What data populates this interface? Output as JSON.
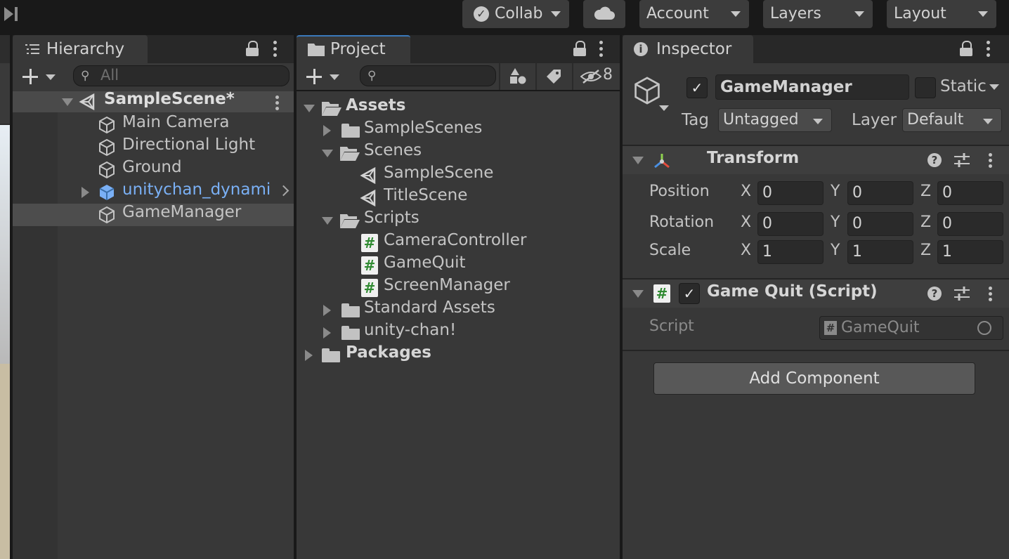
{
  "toolbar": {
    "collab_label": "Collab",
    "account_label": "Account",
    "layers_label": "Layers",
    "layout_label": "Layout"
  },
  "hierarchy": {
    "tab_label": "Hierarchy",
    "search_placeholder": "All",
    "scene_name": "SampleScene*",
    "items": [
      {
        "label": "Main Camera"
      },
      {
        "label": "Directional Light"
      },
      {
        "label": "Ground"
      },
      {
        "label": "unitychan_dynamic"
      },
      {
        "label": "GameManager"
      }
    ]
  },
  "project": {
    "tab_label": "Project",
    "hidden_count": "8",
    "tree": [
      {
        "label": "Assets"
      },
      {
        "label": "SampleScenes"
      },
      {
        "label": "Scenes"
      },
      {
        "label": "SampleScene"
      },
      {
        "label": "TitleScene"
      },
      {
        "label": "Scripts"
      },
      {
        "label": "CameraController"
      },
      {
        "label": "GameQuit"
      },
      {
        "label": "ScreenManager"
      },
      {
        "label": "Standard Assets"
      },
      {
        "label": "unity-chan!"
      },
      {
        "label": "Packages"
      }
    ]
  },
  "inspector": {
    "tab_label": "Inspector",
    "object_name": "GameManager",
    "static_label": "Static",
    "tag_label": "Tag",
    "tag_value": "Untagged",
    "layer_label": "Layer",
    "layer_value": "Default",
    "transform": {
      "title": "Transform",
      "rows": [
        {
          "label": "Position",
          "x": "0",
          "y": "0",
          "z": "0"
        },
        {
          "label": "Rotation",
          "x": "0",
          "y": "0",
          "z": "0"
        },
        {
          "label": "Scale",
          "x": "1",
          "y": "1",
          "z": "1"
        }
      ],
      "axis_x": "X",
      "axis_y": "Y",
      "axis_z": "Z"
    },
    "script_component": {
      "title": "Game Quit (Script)",
      "script_label": "Script",
      "script_value": "GameQuit"
    },
    "add_component_label": "Add Component"
  },
  "colors": {
    "toolbar_bg": "#191919",
    "panel_bg": "#383838",
    "selection_bg": "#4d4d4d",
    "prefab_text": "#7ab0f5"
  }
}
